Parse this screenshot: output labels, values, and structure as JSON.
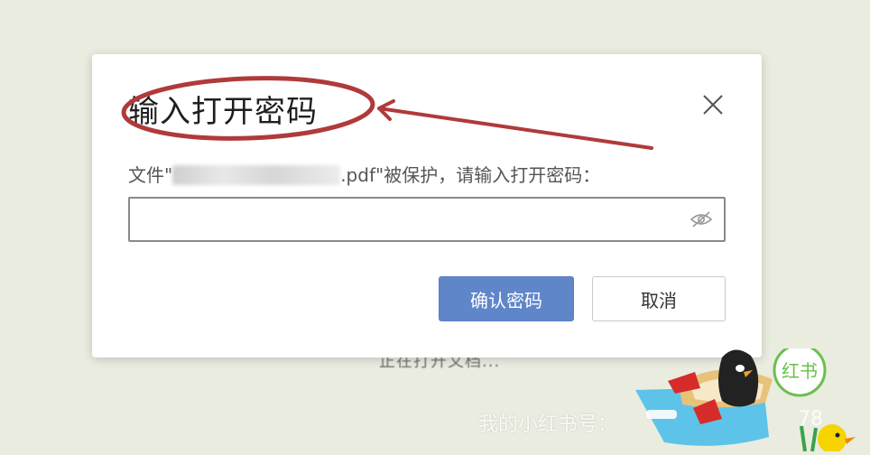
{
  "background": {
    "loading_text": "正在打开文档...",
    "watermark_text": "我的小红书号：",
    "watermark_number": "78"
  },
  "dialog": {
    "title": "输入打开密码",
    "description_prefix": "文件\"",
    "description_suffix": ".pdf\"被保护，请输入打开密码：",
    "password_value": "",
    "password_placeholder": "",
    "confirm_label": "确认密码",
    "cancel_label": "取消",
    "close_icon": "close-icon",
    "eye_icon": "eye-hidden-icon"
  },
  "colors": {
    "confirm_button": "#5f86c9",
    "annotation": "#b03a3a",
    "background": "#e9ecdf"
  },
  "sticker": {
    "badge_text": "红书"
  }
}
